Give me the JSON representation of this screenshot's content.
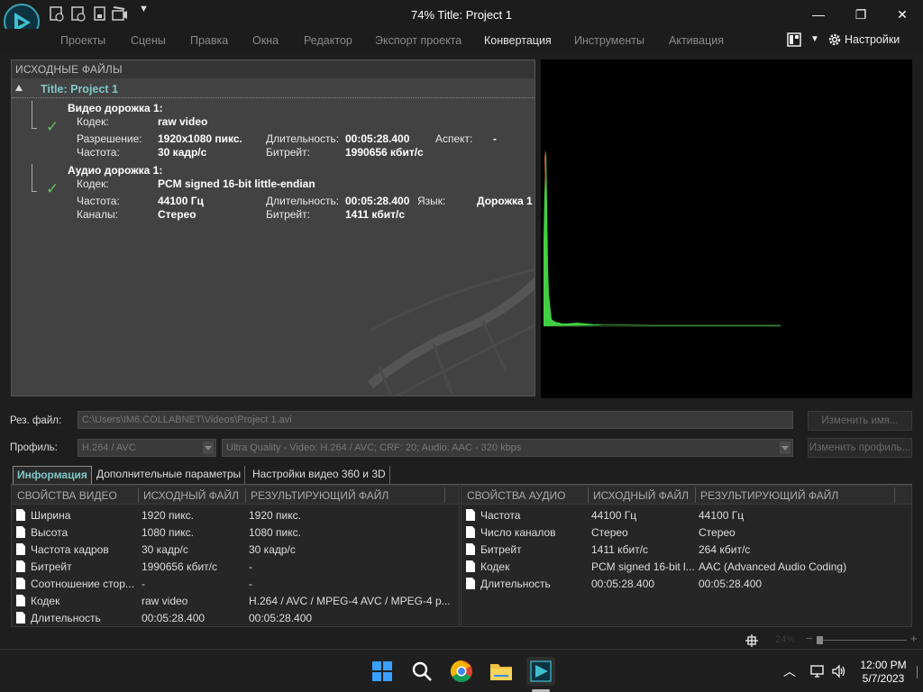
{
  "window": {
    "title": "74% Title: Project 1",
    "controls": {
      "minimize": "—",
      "maximize": "❐",
      "close": "✕"
    }
  },
  "menu": {
    "items": [
      "Проекты",
      "Сцены",
      "Правка",
      "Окна",
      "Редактор",
      "Экспорт проекта",
      "Конвертация",
      "Инструменты",
      "Активация"
    ],
    "active": "Конвертация",
    "settings_label": "Настройки"
  },
  "source": {
    "header": "ИСХОДНЫЕ ФАЙЛЫ",
    "project_title": "Title: Project 1",
    "video": {
      "heading": "Видео дорожка 1:",
      "codec_label": "Кодек:",
      "codec": "raw video",
      "resolution_label": "Разрешение:",
      "resolution": "1920x1080 пикс.",
      "duration_label": "Длительность:",
      "duration": "00:05:28.400",
      "aspect_label": "Аспект:",
      "aspect": "-",
      "framerate_label": "Частота:",
      "framerate": "30 кадр/с",
      "bitrate_label": "Битрейт:",
      "bitrate": "1990656 кбит/с"
    },
    "audio": {
      "heading": "Аудио дорожка 1:",
      "codec_label": "Кодек:",
      "codec": "PCM signed 16-bit little-endian",
      "rate_label": "Частота:",
      "rate": "44100 Гц",
      "duration_label": "Длительность:",
      "duration": "00:05:28.400",
      "lang_label": "Язык:",
      "lang": "Дорожка 1",
      "channels_label": "Каналы:",
      "channels": "Стерео",
      "bitrate_label": "Битрейт:",
      "bitrate": "1411 кбит/с"
    }
  },
  "output": {
    "file_label": "Рез. файл:",
    "file_path": "C:\\Users\\IM6.COLLABNET\\Videos\\Project 1.avi",
    "rename_button": "Изменить имя...",
    "profile_label": "Профиль:",
    "profile_format": "H.264 / AVC",
    "profile_preset": "Ultra Quality - Video: H.264 / AVC; CRF: 20; Audio: AAC - 320 kbps",
    "change_profile_button": "Изменить профиль..."
  },
  "tabs": [
    "Информация",
    "Дополнительные параметры",
    "Настройки видео 360 и 3D"
  ],
  "video_props": {
    "headers": [
      "СВОЙСТВА ВИДЕО",
      "ИСХОДНЫЙ ФАЙЛ",
      "РЕЗУЛЬТИРУЮЩИЙ ФАЙЛ"
    ],
    "rows": [
      [
        "Ширина",
        "1920 пикс.",
        "1920 пикс."
      ],
      [
        "Высота",
        "1080 пикс.",
        "1080 пикс."
      ],
      [
        "Частота кадров",
        "30 кадр/с",
        "30 кадр/с"
      ],
      [
        "Битрейт",
        "1990656 кбит/с",
        "-"
      ],
      [
        "Соотношение стор...",
        "-",
        "-"
      ],
      [
        "Кодек",
        "raw video",
        "H.264 / AVC / MPEG-4 AVC / MPEG-4 p..."
      ],
      [
        "Длительность",
        "00:05:28.400",
        "00:05:28.400"
      ]
    ]
  },
  "audio_props": {
    "headers": [
      "СВОЙСТВА АУДИО",
      "ИСХОДНЫЙ ФАЙЛ",
      "РЕЗУЛЬТИРУЮЩИЙ ФАЙЛ"
    ],
    "rows": [
      [
        "Частота",
        "44100 Гц",
        "44100 Гц"
      ],
      [
        "Число каналов",
        "Стерео",
        "Стерео"
      ],
      [
        "Битрейт",
        "1411 кбит/с",
        "264 кбит/с"
      ],
      [
        "Кодек",
        "PCM signed 16-bit l...",
        "AAC (Advanced Audio Coding)"
      ],
      [
        "Длительность",
        "00:05:28.400",
        "00:05:28.400"
      ]
    ]
  },
  "status": {
    "zoom": "24%"
  },
  "taskbar": {
    "time": "12:00 PM",
    "date": "5/7/2023"
  },
  "colors": {
    "accent": "#7fc7c7",
    "check": "#5ec35e"
  }
}
